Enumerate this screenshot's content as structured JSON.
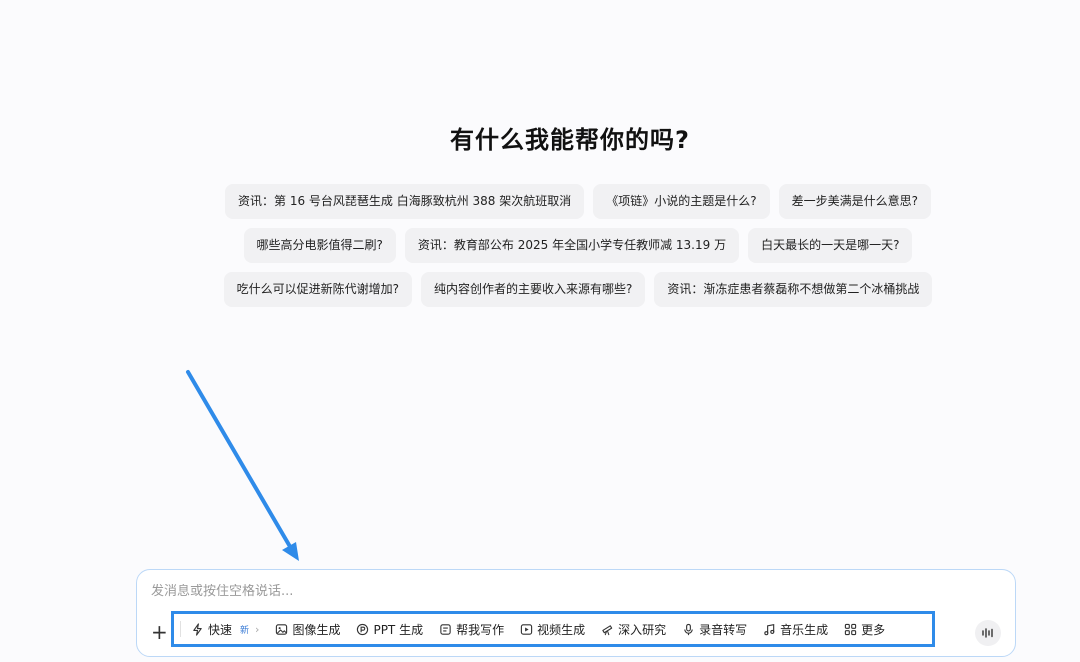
{
  "heading": "有什么我能帮你的吗?",
  "suggestions": {
    "row1": [
      "资讯：第 16 号台风琵琶生成 白海豚致杭州 388 架次航班取消",
      "《项链》小说的主题是什么?",
      "差一步美满是什么意思?"
    ],
    "row2": [
      "哪些高分电影值得二刷?",
      "资讯：教育部公布 2025 年全国小学专任教师减 13.19 万",
      "白天最长的一天是哪一天?"
    ],
    "row3": [
      "吃什么可以促进新陈代谢增加?",
      "纯内容创作者的主要收入来源有哪些?",
      "资讯：渐冻症患者蔡磊称不想做第二个冰桶挑战"
    ]
  },
  "composer": {
    "placeholder": "发消息或按住空格说话...",
    "value": ""
  },
  "tools": [
    {
      "label": "快速",
      "icon": "lightning-icon",
      "badge": "新"
    },
    {
      "label": "图像生成",
      "icon": "image-icon"
    },
    {
      "label": "PPT 生成",
      "icon": "ppt-icon"
    },
    {
      "label": "帮我写作",
      "icon": "document-icon"
    },
    {
      "label": "视频生成",
      "icon": "video-icon"
    },
    {
      "label": "深入研究",
      "icon": "telescope-icon"
    },
    {
      "label": "录音转写",
      "icon": "microphone-icon"
    },
    {
      "label": "音乐生成",
      "icon": "music-note-icon"
    },
    {
      "label": "更多",
      "icon": "grid-icon"
    }
  ],
  "colors": {
    "accent": "#2f8be9",
    "chip_bg": "#f1f1f3",
    "composer_border": "#bcd8f7"
  }
}
